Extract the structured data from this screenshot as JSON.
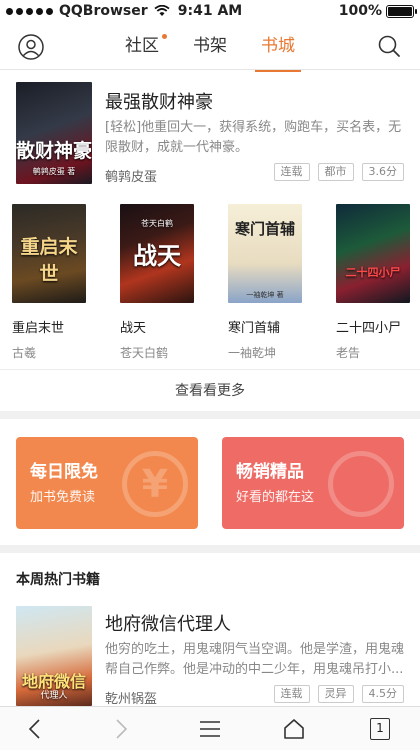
{
  "status_bar": {
    "carrier": "QQBrowser",
    "time": "9:41 AM",
    "battery": "100%",
    "battery_level": 1.0
  },
  "nav": {
    "tabs": [
      {
        "label": "社区",
        "has_dot": true
      },
      {
        "label": "书架",
        "has_dot": false
      },
      {
        "label": "书城",
        "active": true
      }
    ],
    "icons": [
      "user-icon",
      "search-icon"
    ],
    "accent_color": "#e87832"
  },
  "featured": {
    "title": "最强散财神豪",
    "description": "[轻松]他重回大一，获得系统，购跑车，买名表，无限散财，成就一代神豪。",
    "author": "鹌鹑皮蛋",
    "tags": [
      "连载",
      "都市",
      "3.6分"
    ],
    "cover_text": "散财神豪",
    "cover_subtext": "鹌鹑皮蛋 著"
  },
  "grid": [
    {
      "title": "重启末世",
      "author": "古羲",
      "cover_text": "重启末世"
    },
    {
      "title": "战天",
      "author": "苍天白鹤",
      "cover_text": "战天",
      "cover_subtext": "苍天白鹤"
    },
    {
      "title": "寒门首辅",
      "author": "一袖乾坤",
      "cover_text": "寒门首辅",
      "cover_subtext": "一袖乾坤 著"
    },
    {
      "title": "二十四小尸",
      "author": "老告",
      "cover_text": "二十四小尸"
    }
  ],
  "see_more": "查看看更多",
  "promos": [
    {
      "title": "每日限免",
      "subtitle": "加书免费读",
      "color": "#f2884e",
      "glyph": "¥"
    },
    {
      "title": "畅销精品",
      "subtitle": "好看的都在这",
      "color": "#ef6c66",
      "glyph": ""
    }
  ],
  "hot_section": {
    "heading": "本周热门书籍",
    "book": {
      "title": "地府微信代理人",
      "description": "他穷的吃土，用鬼魂阴气当空调。他是学渣，用鬼魂帮自己作弊。他是冲动的中二少年，用鬼魂吊打小...",
      "author": "乾州锅盔",
      "tags": [
        "连载",
        "灵异",
        "4.5分"
      ],
      "cover_text": "地府微信",
      "cover_subtext": "代理人"
    }
  },
  "toolbar": {
    "icons": [
      "back-icon",
      "forward-icon",
      "menu-icon",
      "home-icon",
      "tabs-icon"
    ],
    "tabs_count": "1"
  }
}
